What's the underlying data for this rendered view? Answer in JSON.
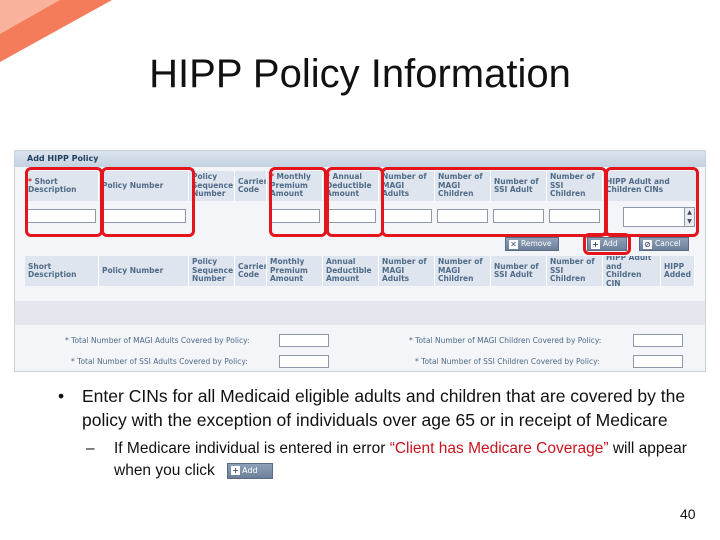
{
  "slide": {
    "title": "HIPP Policy Information",
    "page_number": "40"
  },
  "form": {
    "header": "Add HIPP Policy",
    "columns": [
      {
        "required": "* ",
        "label": "Short Description"
      },
      {
        "required": "",
        "label": "Policy Number"
      },
      {
        "required": "",
        "label": "Policy Sequence Number"
      },
      {
        "required": "",
        "label": "Carrier Code"
      },
      {
        "required": "* ",
        "label": "Monthly Premium Amount"
      },
      {
        "required": "* ",
        "label": "Annual Deductible Amount"
      },
      {
        "required": "",
        "label": "Number of MAGI Adults"
      },
      {
        "required": "",
        "label": "Number of MAGI Children"
      },
      {
        "required": "",
        "label": "Number of SSI Adult"
      },
      {
        "required": "",
        "label": "Number of SSI Children"
      },
      {
        "required": "",
        "label": "HIPP Adult and Children CINs"
      }
    ],
    "buttons": {
      "remove": "Remove",
      "add": "Add",
      "cancel": "Cancel"
    }
  },
  "table": {
    "columns": [
      "Short Description",
      "Policy Number",
      "Policy Sequence Number",
      "Carrier Code",
      "Monthly Premium Amount",
      "Annual Deductible Amount",
      "Number of MAGI Adults",
      "Number of MAGI Children",
      "Number of SSI Adult",
      "Number of SSI Children",
      "HIPP Adult and Children CIN",
      "HIPP Added"
    ]
  },
  "totals": {
    "magi_adults": "* Total Number of MAGI Adults Covered by Policy:",
    "magi_children": "* Total Number of MAGI Children Covered by Policy:",
    "ssi_adults": "* Total Number of SSI Adults Covered by Policy:",
    "ssi_children": "* Total Number of SSI Children Covered by Policy:"
  },
  "bullets": {
    "main": "Enter CINs for all Medicaid eligible adults and children that are covered by the policy with the exception of individuals over age 65 or in receipt of Medicare",
    "sub_prefix": "If Medicare individual is entered in error ",
    "sub_quote": "“Client has Medicare Coverage”",
    "sub_suffix": " will appear when you click",
    "inline_button": "Add"
  },
  "colors": {
    "highlight": "#e3141c",
    "header_text": "#4f6b88",
    "quote_text": "#c8141e"
  }
}
